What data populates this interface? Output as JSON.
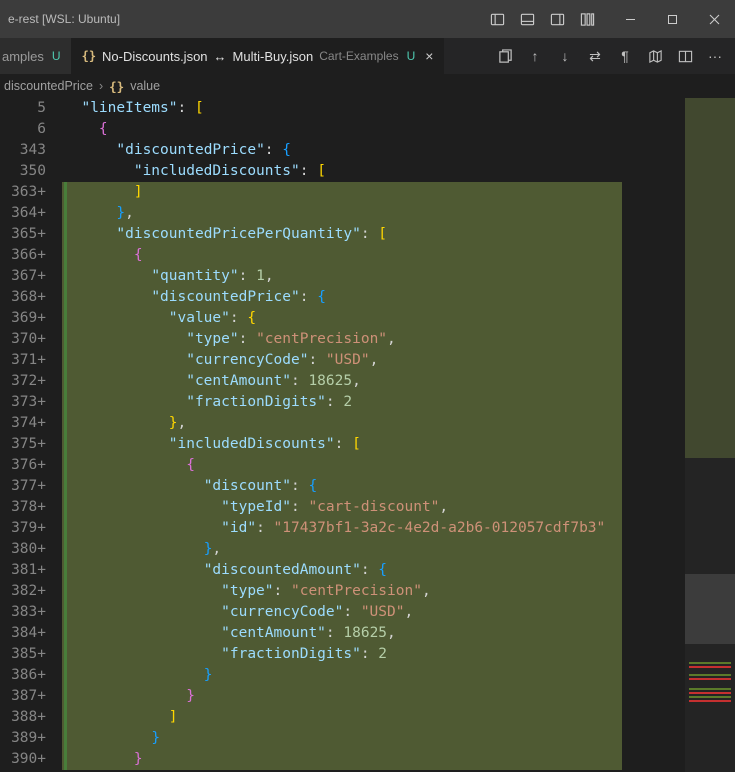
{
  "window": {
    "title_fragment": "e-rest [WSL: Ubuntu]"
  },
  "tabs": {
    "inactive": {
      "label_fragment": "amples",
      "mod": "U"
    },
    "active": {
      "left_file": "No-Discounts.json",
      "arrow": "↔",
      "right_file": "Multi-Buy.json",
      "folder": "Cart-Examples",
      "mod": "U"
    }
  },
  "breadcrumb": {
    "seg1": "discountedPrice",
    "seg2": "value"
  },
  "minimap": {
    "red_lines": [
      568,
      580,
      594,
      602
    ],
    "green_lines": [
      564,
      576,
      590,
      598
    ]
  },
  "lines": [
    {
      "num": "5",
      "sticky": true,
      "ind": 1,
      "tokens": [
        {
          "c": "pk",
          "t": "\"lineItems\""
        },
        {
          "c": "p",
          "t": ": "
        },
        {
          "c": "br",
          "t": "["
        }
      ]
    },
    {
      "num": "6",
      "sticky": true,
      "ind": 2,
      "tokens": [
        {
          "c": "br2",
          "t": "{"
        }
      ]
    },
    {
      "num": "343",
      "sticky": true,
      "ind": 3,
      "tokens": [
        {
          "c": "pk",
          "t": "\"discountedPrice\""
        },
        {
          "c": "p",
          "t": ": "
        },
        {
          "c": "br3",
          "t": "{"
        }
      ]
    },
    {
      "num": "350",
      "sticky": true,
      "ind": 4,
      "tokens": [
        {
          "c": "pk",
          "t": "\"includedDiscounts\""
        },
        {
          "c": "p",
          "t": ": "
        },
        {
          "c": "br",
          "t": "["
        }
      ]
    },
    {
      "num": "363+",
      "added": true,
      "ind": 4,
      "tokens": [
        {
          "c": "br",
          "t": "]"
        }
      ]
    },
    {
      "num": "364+",
      "added": true,
      "ind": 3,
      "tokens": [
        {
          "c": "br3",
          "t": "}"
        },
        {
          "c": "p",
          "t": ","
        }
      ]
    },
    {
      "num": "365+",
      "added": true,
      "ind": 3,
      "tokens": [
        {
          "c": "pk",
          "t": "\"discountedPricePerQuantity\""
        },
        {
          "c": "p",
          "t": ": "
        },
        {
          "c": "br",
          "t": "["
        }
      ]
    },
    {
      "num": "366+",
      "added": true,
      "ind": 4,
      "tokens": [
        {
          "c": "br2",
          "t": "{"
        }
      ]
    },
    {
      "num": "367+",
      "added": true,
      "ind": 5,
      "tokens": [
        {
          "c": "pk",
          "t": "\"quantity\""
        },
        {
          "c": "p",
          "t": ": "
        },
        {
          "c": "n",
          "t": "1"
        },
        {
          "c": "p",
          "t": ","
        }
      ]
    },
    {
      "num": "368+",
      "added": true,
      "ind": 5,
      "tokens": [
        {
          "c": "pk",
          "t": "\"discountedPrice\""
        },
        {
          "c": "p",
          "t": ": "
        },
        {
          "c": "br3",
          "t": "{"
        }
      ]
    },
    {
      "num": "369+",
      "added": true,
      "ind": 6,
      "tokens": [
        {
          "c": "pk",
          "t": "\"value\""
        },
        {
          "c": "p",
          "t": ": "
        },
        {
          "c": "br",
          "t": "{"
        }
      ]
    },
    {
      "num": "370+",
      "added": true,
      "ind": 7,
      "tokens": [
        {
          "c": "pk",
          "t": "\"type\""
        },
        {
          "c": "p",
          "t": ": "
        },
        {
          "c": "s",
          "t": "\"centPrecision\""
        },
        {
          "c": "p",
          "t": ","
        }
      ]
    },
    {
      "num": "371+",
      "added": true,
      "ind": 7,
      "tokens": [
        {
          "c": "pk",
          "t": "\"currencyCode\""
        },
        {
          "c": "p",
          "t": ": "
        },
        {
          "c": "s",
          "t": "\"USD\""
        },
        {
          "c": "p",
          "t": ","
        }
      ]
    },
    {
      "num": "372+",
      "added": true,
      "ind": 7,
      "tokens": [
        {
          "c": "pk",
          "t": "\"centAmount\""
        },
        {
          "c": "p",
          "t": ": "
        },
        {
          "c": "n",
          "t": "18625"
        },
        {
          "c": "p",
          "t": ","
        }
      ]
    },
    {
      "num": "373+",
      "added": true,
      "ind": 7,
      "tokens": [
        {
          "c": "pk",
          "t": "\"fractionDigits\""
        },
        {
          "c": "p",
          "t": ": "
        },
        {
          "c": "n",
          "t": "2"
        }
      ]
    },
    {
      "num": "374+",
      "added": true,
      "ind": 6,
      "tokens": [
        {
          "c": "br",
          "t": "}"
        },
        {
          "c": "p",
          "t": ","
        }
      ]
    },
    {
      "num": "375+",
      "added": true,
      "ind": 6,
      "tokens": [
        {
          "c": "pk",
          "t": "\"includedDiscounts\""
        },
        {
          "c": "p",
          "t": ": "
        },
        {
          "c": "br",
          "t": "["
        }
      ]
    },
    {
      "num": "376+",
      "added": true,
      "ind": 7,
      "tokens": [
        {
          "c": "br2",
          "t": "{"
        }
      ]
    },
    {
      "num": "377+",
      "added": true,
      "ind": 8,
      "tokens": [
        {
          "c": "pk",
          "t": "\"discount\""
        },
        {
          "c": "p",
          "t": ": "
        },
        {
          "c": "br3",
          "t": "{"
        }
      ]
    },
    {
      "num": "378+",
      "added": true,
      "ind": 9,
      "tokens": [
        {
          "c": "pk",
          "t": "\"typeId\""
        },
        {
          "c": "p",
          "t": ": "
        },
        {
          "c": "s",
          "t": "\"cart-discount\""
        },
        {
          "c": "p",
          "t": ","
        }
      ]
    },
    {
      "num": "379+",
      "added": true,
      "ind": 9,
      "tokens": [
        {
          "c": "pk",
          "t": "\"id\""
        },
        {
          "c": "p",
          "t": ": "
        },
        {
          "c": "s",
          "t": "\"17437bf1-3a2c-4e2d-a2b6-012057cdf7b3\""
        }
      ]
    },
    {
      "num": "380+",
      "added": true,
      "ind": 8,
      "tokens": [
        {
          "c": "br3",
          "t": "}"
        },
        {
          "c": "p",
          "t": ","
        }
      ]
    },
    {
      "num": "381+",
      "added": true,
      "ind": 8,
      "tokens": [
        {
          "c": "pk",
          "t": "\"discountedAmount\""
        },
        {
          "c": "p",
          "t": ": "
        },
        {
          "c": "br3",
          "t": "{"
        }
      ]
    },
    {
      "num": "382+",
      "added": true,
      "ind": 9,
      "tokens": [
        {
          "c": "pk",
          "t": "\"type\""
        },
        {
          "c": "p",
          "t": ": "
        },
        {
          "c": "s",
          "t": "\"centPrecision\""
        },
        {
          "c": "p",
          "t": ","
        }
      ]
    },
    {
      "num": "383+",
      "added": true,
      "ind": 9,
      "tokens": [
        {
          "c": "pk",
          "t": "\"currencyCode\""
        },
        {
          "c": "p",
          "t": ": "
        },
        {
          "c": "s",
          "t": "\"USD\""
        },
        {
          "c": "p",
          "t": ","
        }
      ]
    },
    {
      "num": "384+",
      "added": true,
      "ind": 9,
      "tokens": [
        {
          "c": "pk",
          "t": "\"centAmount\""
        },
        {
          "c": "p",
          "t": ": "
        },
        {
          "c": "n",
          "t": "18625"
        },
        {
          "c": "p",
          "t": ","
        }
      ]
    },
    {
      "num": "385+",
      "added": true,
      "ind": 9,
      "tokens": [
        {
          "c": "pk",
          "t": "\"fractionDigits\""
        },
        {
          "c": "p",
          "t": ": "
        },
        {
          "c": "n",
          "t": "2"
        }
      ]
    },
    {
      "num": "386+",
      "added": true,
      "ind": 8,
      "tokens": [
        {
          "c": "br3",
          "t": "}"
        }
      ]
    },
    {
      "num": "387+",
      "added": true,
      "ind": 7,
      "tokens": [
        {
          "c": "br2",
          "t": "}"
        }
      ]
    },
    {
      "num": "388+",
      "added": true,
      "ind": 6,
      "tokens": [
        {
          "c": "br",
          "t": "]"
        }
      ]
    },
    {
      "num": "389+",
      "added": true,
      "ind": 5,
      "tokens": [
        {
          "c": "br3",
          "t": "}"
        }
      ]
    },
    {
      "num": "390+",
      "added": true,
      "ind": 4,
      "tokens": [
        {
          "c": "br2",
          "t": "}"
        }
      ]
    }
  ]
}
